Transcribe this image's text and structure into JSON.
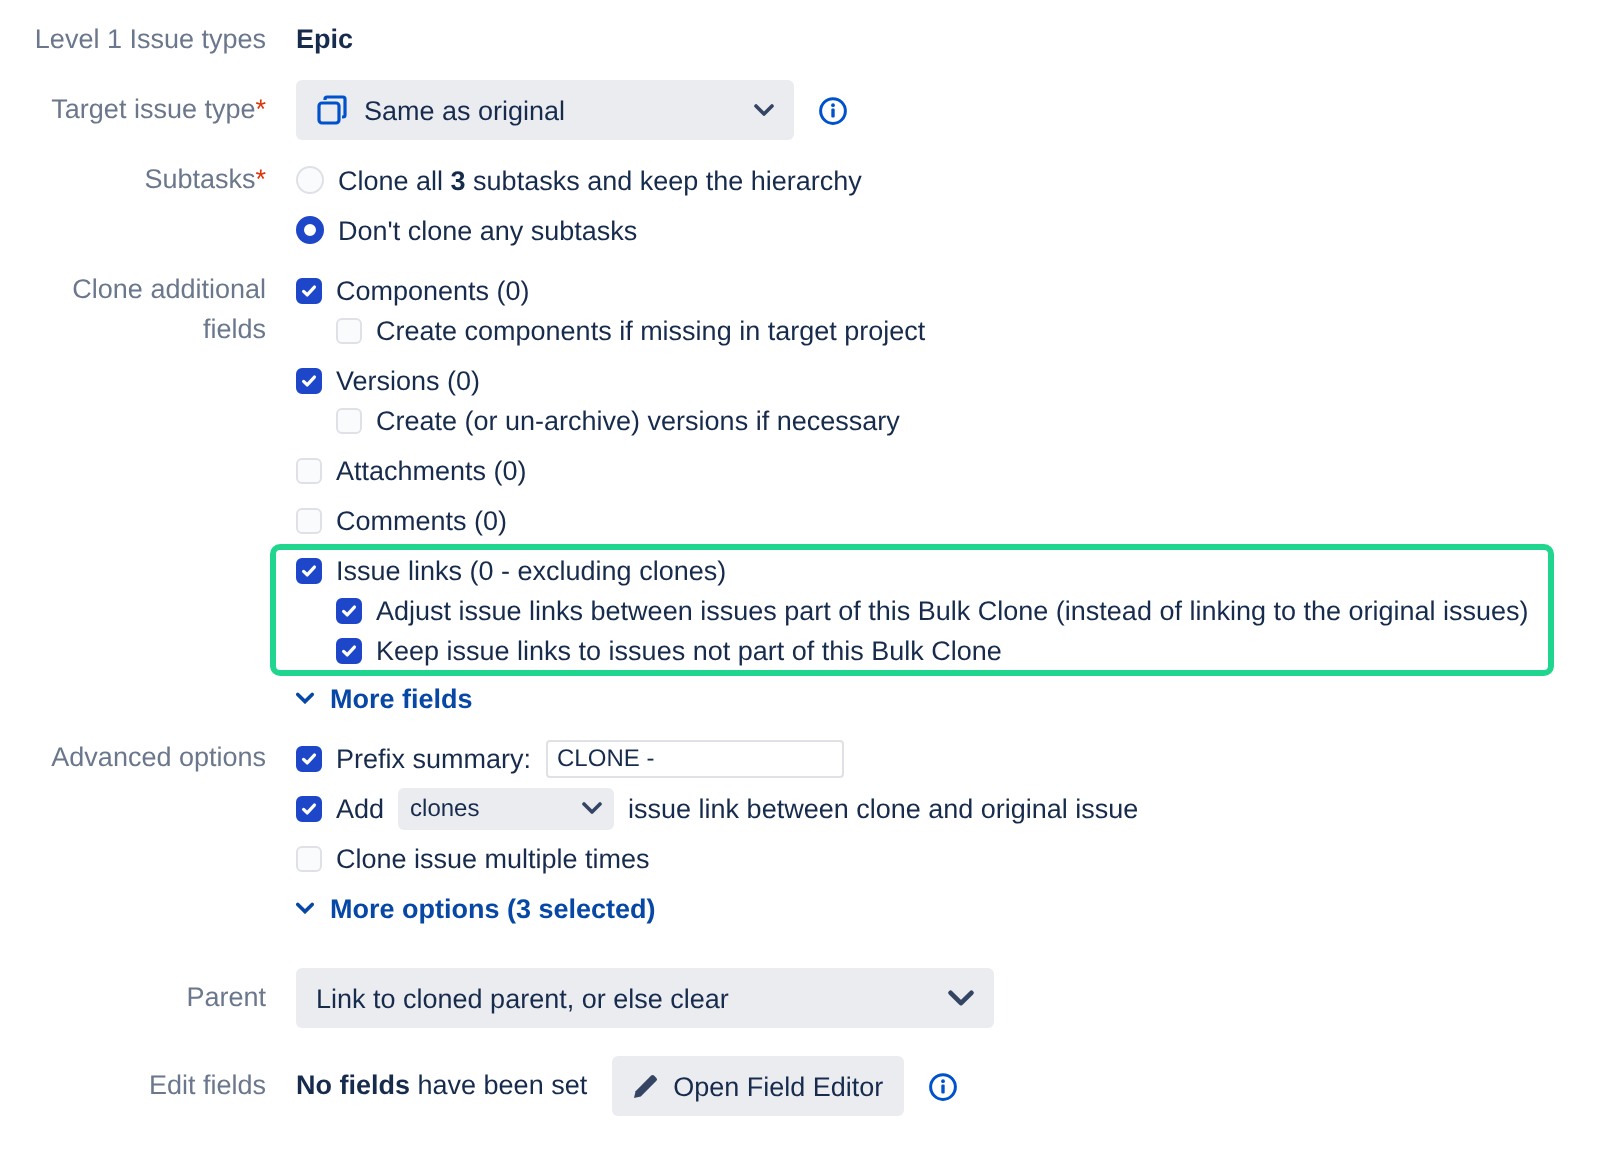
{
  "rows": [
    {
      "label": "Level 1 Issue types",
      "kind": "text",
      "value": "Epic"
    },
    {
      "label": "Target issue type",
      "required_mark": "*",
      "kind": "select",
      "value": "Same as original",
      "icon": true,
      "info": true
    },
    {
      "label": "Subtasks",
      "required_mark": "*",
      "kind": "radios",
      "options": [
        {
          "label": "Clone all **3** subtasks and keep the hierarchy",
          "selected": false
        },
        {
          "label": "Don't clone any subtasks",
          "selected": true
        }
      ]
    },
    {
      "label": "Clone additional fields",
      "kind": "checks",
      "items": [
        {
          "kind": "plain",
          "label": "Components (0)",
          "checked": true,
          "children": [
            {
              "kind": "plain",
              "label": "Create components if missing in target project",
              "checked": false
            }
          ]
        },
        {
          "kind": "plain",
          "label": "Versions (0)",
          "checked": true,
          "children": [
            {
              "kind": "plain",
              "label": "Create (or un-archive) versions if necessary",
              "checked": false
            }
          ]
        },
        {
          "kind": "plain",
          "label": "Attachments (0)",
          "checked": false
        },
        {
          "kind": "plain",
          "label": "Comments (0)",
          "checked": false
        },
        {
          "kind": "plain",
          "label": "Issue links (0 - excluding clones)",
          "checked": true,
          "highlighted": true,
          "children": [
            {
              "kind": "plain",
              "label": "Adjust issue links between issues part of this Bulk Clone (instead of linking to the original issues)",
              "checked": true
            },
            {
              "kind": "plain",
              "label": "Keep issue links to issues not part of this Bulk Clone",
              "checked": true
            }
          ]
        }
      ],
      "link": "More fields"
    },
    {
      "label": "Advanced options",
      "kind": "checks",
      "items": [
        {
          "kind": "input",
          "label": "Prefix summary:",
          "value": "CLONE -",
          "checked": true
        },
        {
          "kind": "select",
          "label": "Add",
          "value": "clones",
          "suffix": "issue link between clone and original issue",
          "checked": true
        },
        {
          "kind": "plain",
          "label": "Clone issue multiple times",
          "checked": false
        }
      ],
      "link": "More options (3 selected)"
    },
    {
      "label": "Parent",
      "kind": "select",
      "value": "Link to cloned parent, or else clear"
    },
    {
      "label": "Edit fields",
      "kind": "edit",
      "value": "**No fields** have been set",
      "button": "Open Field Editor",
      "info": true
    }
  ]
}
